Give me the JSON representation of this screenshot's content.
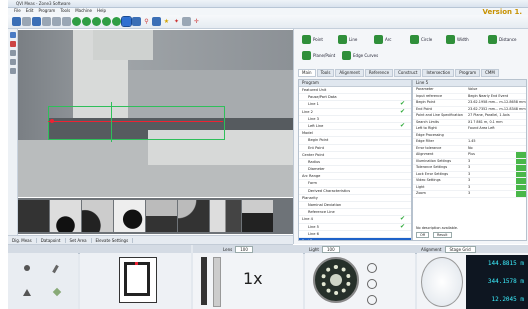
{
  "window": {
    "title": "QVI Meas - Zone3 Software",
    "version": "Version 1."
  },
  "menu": [
    "File",
    "Edit",
    "Program",
    "Tools",
    "Machine",
    "Help"
  ],
  "ribbon": {
    "buttons": [
      "Point",
      "Line",
      "Arc",
      "Circle",
      "Width",
      "Distance"
    ],
    "row2": [
      "Plane/Point",
      "Edge Curves"
    ]
  },
  "right_tabs": [
    "Main",
    "Tools",
    "Alignment",
    "Reference",
    "Construct",
    "Intersection",
    "Program",
    "CMM"
  ],
  "tree": {
    "header": "Program",
    "rows": [
      {
        "label": "Featured Unit",
        "check": false
      },
      {
        "label": "Pause/Part Data",
        "check": false
      },
      {
        "label": "Line 1",
        "check": true
      },
      {
        "label": "Line 2",
        "check": true
      },
      {
        "label": "Line 3",
        "check": false
      },
      {
        "label": "Left Line",
        "check": true
      },
      {
        "label": "Model",
        "check": false
      },
      {
        "label": "Begin Point",
        "check": false
      },
      {
        "label": "Ent Point",
        "check": false
      },
      {
        "label": "Center Point",
        "check": false
      },
      {
        "label": "Radius",
        "check": false
      },
      {
        "label": "Diameter",
        "check": false
      },
      {
        "label": "Arc Range",
        "check": false
      },
      {
        "label": "Form",
        "check": false
      },
      {
        "label": "Derived Characteristics",
        "check": false
      },
      {
        "label": "Planarity",
        "check": false
      },
      {
        "label": "Nominal Deviation",
        "check": false
      },
      {
        "label": "Reference Line",
        "check": false
      },
      {
        "label": "Line 4",
        "check": true
      },
      {
        "label": "Line 5",
        "check": true
      },
      {
        "label": "Line 6",
        "check": false
      },
      {
        "label": "End Program",
        "check": false,
        "highlight": true
      }
    ]
  },
  "props": {
    "header": "Line 5",
    "rows": [
      {
        "k": "Parameter",
        "v": "Value"
      },
      {
        "k": "Input reference",
        "v": "Begin Nearly End Event"
      },
      {
        "k": "Begin Point",
        "v": "23.62.1958 mm... m-12.8658 mm"
      },
      {
        "k": "End Point",
        "v": "23.62.7352 mm... m-12.8348 mm"
      },
      {
        "k": "Point and Line Specification",
        "v": "27 Plane, Parallel, 1 Axis"
      },
      {
        "k": "Search Limits",
        "v": "X1 ? 861 m, 0.1 mm"
      },
      {
        "k": "Left to Right",
        "v": "Found Area Left"
      },
      {
        "k": "Edge Processing",
        "v": ""
      },
      {
        "k": "Edge Filter",
        "v": "1.45"
      },
      {
        "k": "Error tolerance",
        "v": "No"
      },
      {
        "k": "Alignment",
        "v": "Plus"
      },
      {
        "k": "Illumination Settings",
        "v": "3"
      },
      {
        "k": "Tolerance Settings",
        "v": "3"
      },
      {
        "k": "Lock Error Settings",
        "v": "3"
      },
      {
        "k": "Video Settings",
        "v": "3"
      },
      {
        "k": "Light",
        "v": "3"
      },
      {
        "k": "Zoom",
        "v": "3"
      }
    ],
    "footer": "No description available.",
    "footer_btns": [
      "Off",
      "Result"
    ]
  },
  "left_tabs": [
    "Dig. Meas",
    "Datapoint",
    "Set Area",
    "Elevate Settings"
  ],
  "dock": {
    "zoom_label": "1x",
    "lens_label": "Lens",
    "lens_value": "100",
    "light_label": "Light",
    "light_value": "100",
    "alignment_label": "Alignment",
    "alignment_value": "Stage Grid",
    "readouts": [
      "144.8815 m",
      "344.1578 m",
      "12.2045 m"
    ]
  }
}
